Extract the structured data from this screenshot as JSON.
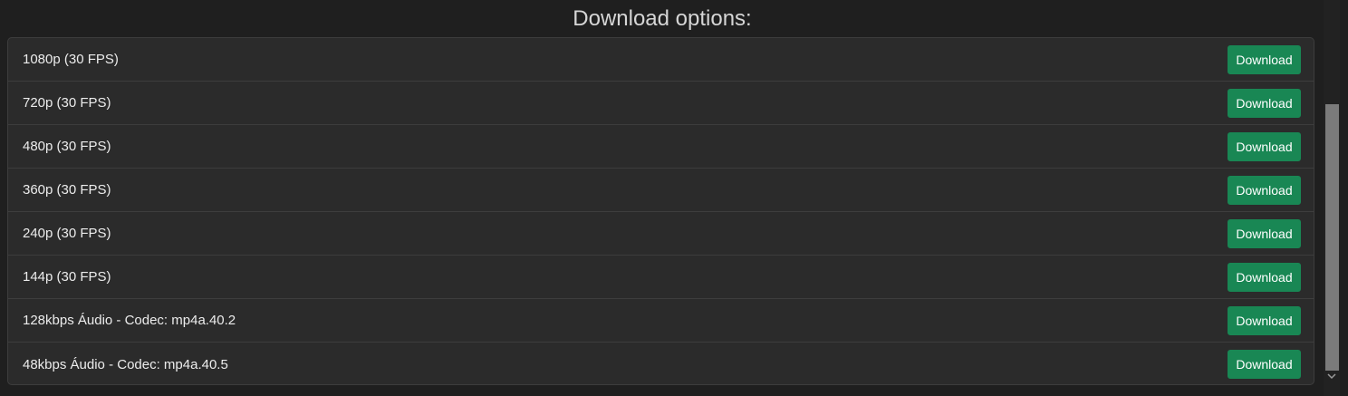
{
  "page": {
    "title": "Download options:"
  },
  "options": [
    {
      "label": "1080p (30 FPS)",
      "button": "Download"
    },
    {
      "label": "720p (30 FPS)",
      "button": "Download"
    },
    {
      "label": "480p (30 FPS)",
      "button": "Download"
    },
    {
      "label": "360p (30 FPS)",
      "button": "Download"
    },
    {
      "label": "240p (30 FPS)",
      "button": "Download"
    },
    {
      "label": "144p (30 FPS)",
      "button": "Download"
    },
    {
      "label": "128kbps Áudio - Codec: mp4a.40.2",
      "button": "Download"
    },
    {
      "label": "48kbps Áudio - Codec: mp4a.40.5",
      "button": "Download"
    }
  ],
  "colors": {
    "background": "#1f1f1f",
    "panel": "#2b2b2b",
    "button": "#198754"
  },
  "scrollbar": {
    "down_arrow_icon": "chevron-down-icon"
  }
}
